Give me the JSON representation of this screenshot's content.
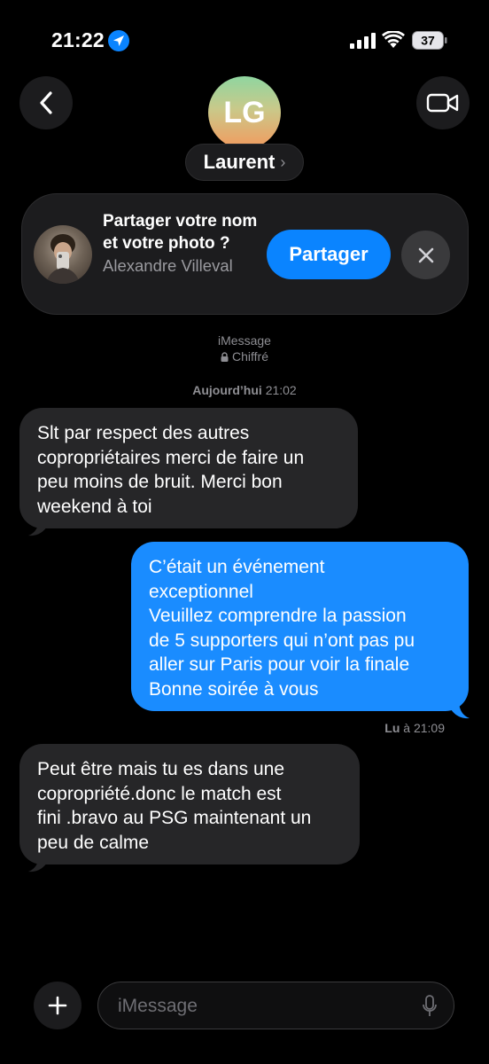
{
  "status_bar": {
    "time": "21:22",
    "battery": "37"
  },
  "contact": {
    "initials": "LG",
    "name": "Laurent",
    "chevron": "›"
  },
  "share_banner": {
    "question": "Partager votre nom et votre photo ?",
    "sender_name": "Alexandre Villeval",
    "share_label": "Partager"
  },
  "conversation": {
    "service": "iMessage",
    "encryption": "Chiffré",
    "date_day": "Aujourd’hui",
    "date_time": "21:02"
  },
  "messages": [
    {
      "direction": "incoming",
      "text": "Slt par respect des autres\ncopropriétaires merci de faire un\npeu moins de bruit. Merci bon\nweekend à toi"
    },
    {
      "direction": "outgoing",
      "text": "C’était un événement\nexceptionnel\nVeuillez comprendre la passion\nde 5 supporters qui n’ont pas pu\naller sur Paris pour voir la finale\nBonne soirée à vous"
    },
    {
      "direction": "incoming",
      "text": "Peut être mais tu es dans une\ncopropriété.donc le match est\nfini .bravo au PSG maintenant un\npeu de calme"
    }
  ],
  "read_receipt": {
    "label": "Lu",
    "time": "à 21:09"
  },
  "composer": {
    "placeholder": "iMessage"
  },
  "icons": {
    "location": "location-arrow-icon",
    "signal": "cellular-signal-icon",
    "wifi": "wifi-icon",
    "battery": "battery-icon",
    "back": "chevron-left-icon",
    "video": "video-camera-icon",
    "close": "close-icon",
    "lock": "lock-icon",
    "plus": "plus-icon",
    "mic": "microphone-icon"
  },
  "colors": {
    "background": "#000000",
    "incoming_bubble": "#262628",
    "outgoing_bubble": "#1a8cff",
    "accent": "#0a84ff"
  }
}
